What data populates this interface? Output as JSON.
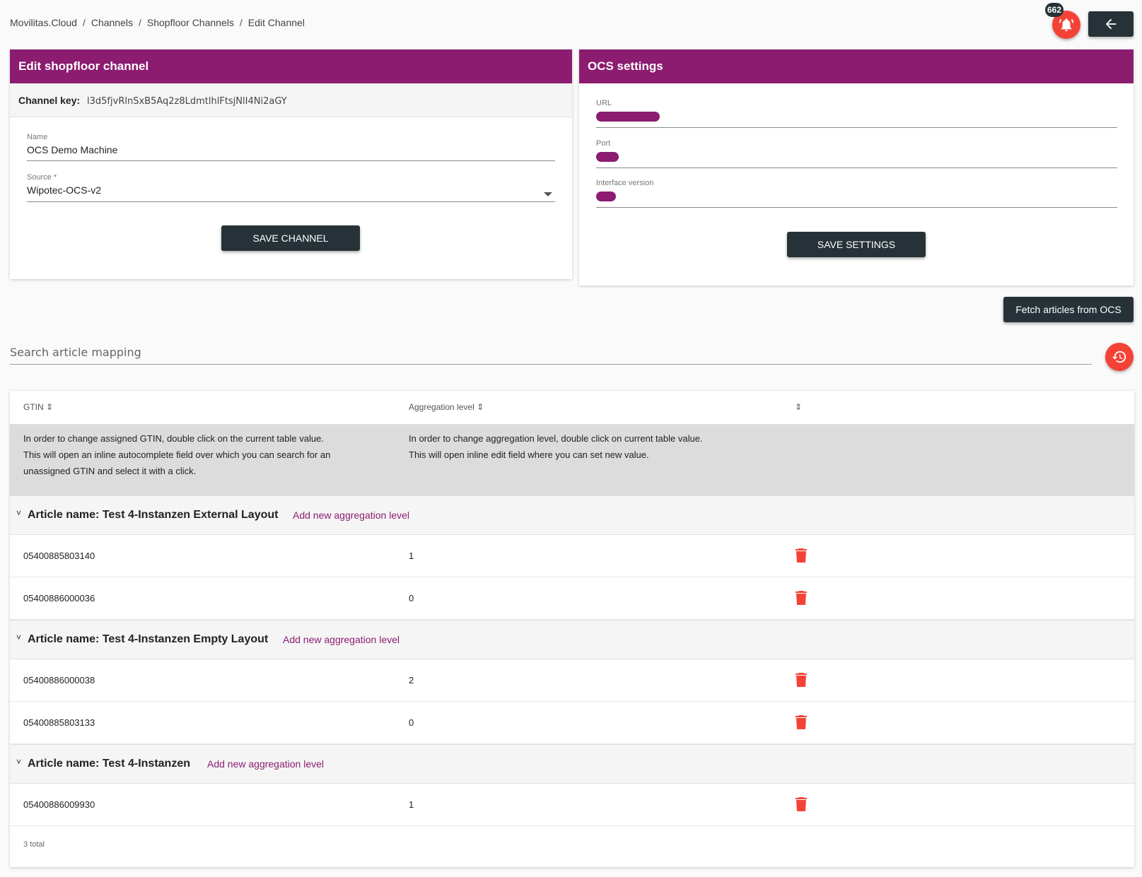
{
  "breadcrumb": {
    "items": [
      "Movilitas.Cloud",
      "Channels",
      "Shopfloor Channels",
      "Edit Channel"
    ],
    "separator": "/"
  },
  "notifications": {
    "count": "662"
  },
  "edit_card": {
    "title": "Edit shopfloor channel",
    "channel_key_label": "Channel key:",
    "channel_key_value": "l3d5fjvRlnSxB5Aq2z8LdmtlhlFtsjNlI4Ni2aGY",
    "name_label": "Name",
    "name_value": "OCS Demo Machine",
    "source_label": "Source *",
    "source_value": "Wipotec-OCS-v2",
    "save_button": "SAVE CHANNEL"
  },
  "ocs_card": {
    "title": "OCS settings",
    "url_label": "URL",
    "port_label": "Port",
    "interface_label": "Interface version",
    "save_button": "SAVE SETTINGS"
  },
  "fetch_button": "Fetch articles from OCS",
  "search": {
    "placeholder": "Search article mapping"
  },
  "table": {
    "columns": [
      "GTIN",
      "Aggregation level",
      ""
    ],
    "help_gtin": [
      "In order to change assigned GTIN, double click on the current table value.",
      "This will open an inline autocomplete field over which you can search for an",
      "unassigned GTIN and select it with a click."
    ],
    "help_aggregation": [
      "In order to change aggregation level, double click on current table value.",
      "This will open inline edit field where you can set new value."
    ],
    "add_link": "Add new aggregation level",
    "groups": [
      {
        "name": "Article name: Test 4-Instanzen External Layout",
        "rows": [
          {
            "gtin": "05400885803140",
            "level": "1"
          },
          {
            "gtin": "05400886000036",
            "level": "0"
          }
        ]
      },
      {
        "name": "Article name: Test 4-Instanzen Empty Layout",
        "rows": [
          {
            "gtin": "05400886000038",
            "level": "2"
          },
          {
            "gtin": "05400885803133",
            "level": "0"
          }
        ]
      },
      {
        "name": "Article name: Test 4-Instanzen",
        "rows": [
          {
            "gtin": "05400886009930",
            "level": "1"
          }
        ]
      }
    ],
    "total": "3 total"
  },
  "colors": {
    "brand": "#8c1c70",
    "dark": "#263238",
    "danger": "#f44336"
  },
  "icons": [
    "bell-icon",
    "arrow-left-icon",
    "history-icon",
    "trash-icon",
    "chevron-down-icon",
    "sort-icon"
  ]
}
